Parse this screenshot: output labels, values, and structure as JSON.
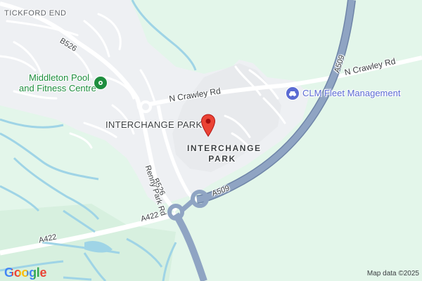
{
  "map": {
    "labels": {
      "tickford_end": "TICKFORD END",
      "b526_top": "B526",
      "b526_bottom": "B526",
      "n_crawley_rd_left": "N Crawley Rd",
      "n_crawley_rd_right": "N Crawley Rd",
      "a509_top": "A509",
      "a509_bottom": "A509",
      "a422_left": "A422",
      "a422_center": "A422",
      "renny_park_rd": "Renny Park Rd",
      "interchange_park_area": "INTERCHANGE PARK",
      "interchange_park_line1": "INTERCHANGE",
      "interchange_park_line2": "PARK"
    },
    "pois": {
      "middleton_line1": "Middleton Pool",
      "middleton_line2": "and Fitness Centre",
      "clm": "CLM Fleet Management"
    },
    "attribution": {
      "logo": "Google",
      "map_data": "Map data ©2025"
    },
    "icons": {
      "pin": "red-location-pin-icon",
      "fitness": "fitness-centre-icon",
      "car": "car-service-icon"
    },
    "colors": {
      "land": "#e3f6ea",
      "urban": "#eef0f3",
      "water": "#9fd4e6",
      "motorway": "#8fa4c3",
      "motorway_casing": "#6f85a8",
      "road": "#ffffff",
      "pin": "#ea4335",
      "poi_green": "#1e8e3e",
      "poi_blue": "#5b6bd3"
    }
  }
}
